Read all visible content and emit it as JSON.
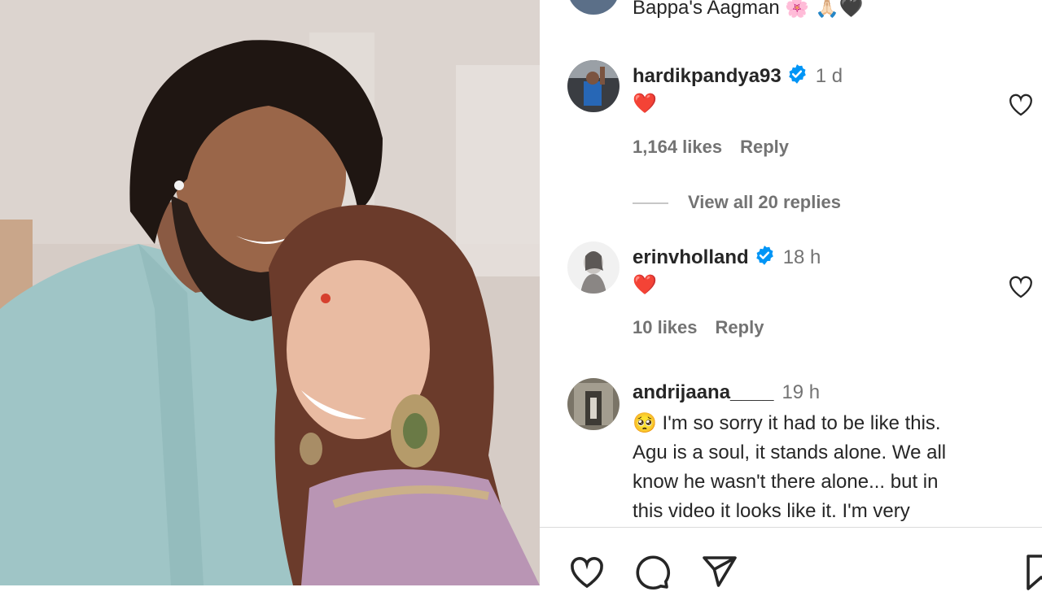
{
  "caption": {
    "text": "Bappa's Aagman",
    "emoji": "🌸 🙏🏻🖤"
  },
  "comments": [
    {
      "username": "hardikpandya93",
      "verified": true,
      "time": "1 d",
      "text": "❤️",
      "likes": "1,164 likes",
      "reply_label": "Reply",
      "view_replies": "View all 20 replies"
    },
    {
      "username": "erinvholland",
      "verified": true,
      "time": "18 h",
      "text": "❤️",
      "likes": "10 likes",
      "reply_label": "Reply"
    },
    {
      "username": "andrijaana____",
      "verified": false,
      "time": "19 h",
      "lines": [
        "🥺 I'm so sorry it had to be like this.",
        "Agu is a soul, it stands alone. We all",
        "know he wasn't there alone... but in",
        "this video it looks like it. I'm very"
      ]
    }
  ],
  "icons": {
    "like": "heart-icon",
    "comment": "comment-icon",
    "share": "share-icon",
    "save": "bookmark-icon"
  },
  "colors": {
    "verified": "#0095f6",
    "heart": "#ed1c24",
    "muted": "#737373"
  }
}
